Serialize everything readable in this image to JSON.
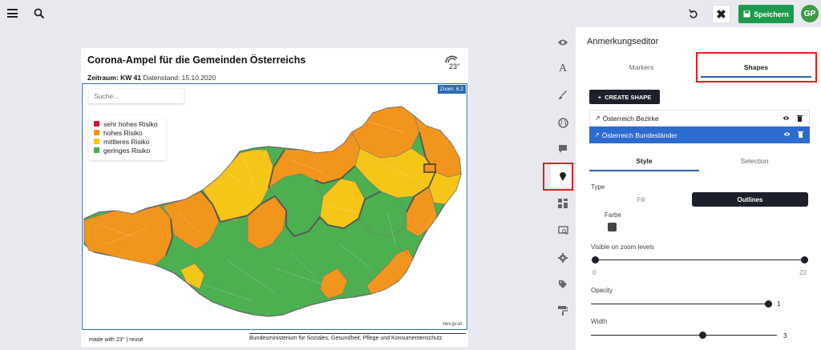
{
  "header": {
    "save_label": "Speichern",
    "avatar_initials": "GP"
  },
  "editor": {
    "title": "Anmerkungseditor",
    "tabs": [
      {
        "label": "Markers"
      },
      {
        "label": "Shapes"
      }
    ],
    "create_label": "CREATE SHAPE",
    "layers": [
      {
        "label": "Österreich Bezirke"
      },
      {
        "label": "Österreich Bundesländer"
      }
    ],
    "subtabs": [
      {
        "label": "Style"
      },
      {
        "label": "Selection"
      }
    ],
    "type_label": "Type",
    "type_options": [
      {
        "label": "Fill"
      },
      {
        "label": "Outlines"
      }
    ],
    "color_label": "Farbe",
    "zoom_label": "Visible on zoom levels",
    "zoom_min": "0",
    "zoom_max": "22",
    "opacity_label": "Opacity",
    "opacity_value": "1",
    "width_label": "Width",
    "width_value": "3"
  },
  "map": {
    "title": "Corona-Ampel für die Gemeinden Österreichs",
    "logo_text": "23°",
    "period_label": "Zeitraum:",
    "period_value": "KW 41",
    "date_text": "Datenstand: 15.10.2020",
    "zoom_badge": "Zoom: 6.2",
    "search_placeholder": "Suche...",
    "legend": [
      {
        "label": "sehr hohes Risiko",
        "color": "#d0182f"
      },
      {
        "label": "hohes Risiko",
        "color": "#f2951c"
      },
      {
        "label": "mittleres Risiko",
        "color": "#f5c518"
      },
      {
        "label": "geringes Risiko",
        "color": "#4caf50"
      }
    ],
    "credit": "bev.gv.at",
    "footer_left": "made with 23° | reuse",
    "footer_right": "Bundesministerium für Soziales, Gesundheit, Pflege und Konsumentenschutz"
  },
  "colors": {
    "accent": "#2f5fa8",
    "save": "#1e9a4f",
    "selected_layer": "#2d6bcf",
    "highlight": "#e02020"
  }
}
